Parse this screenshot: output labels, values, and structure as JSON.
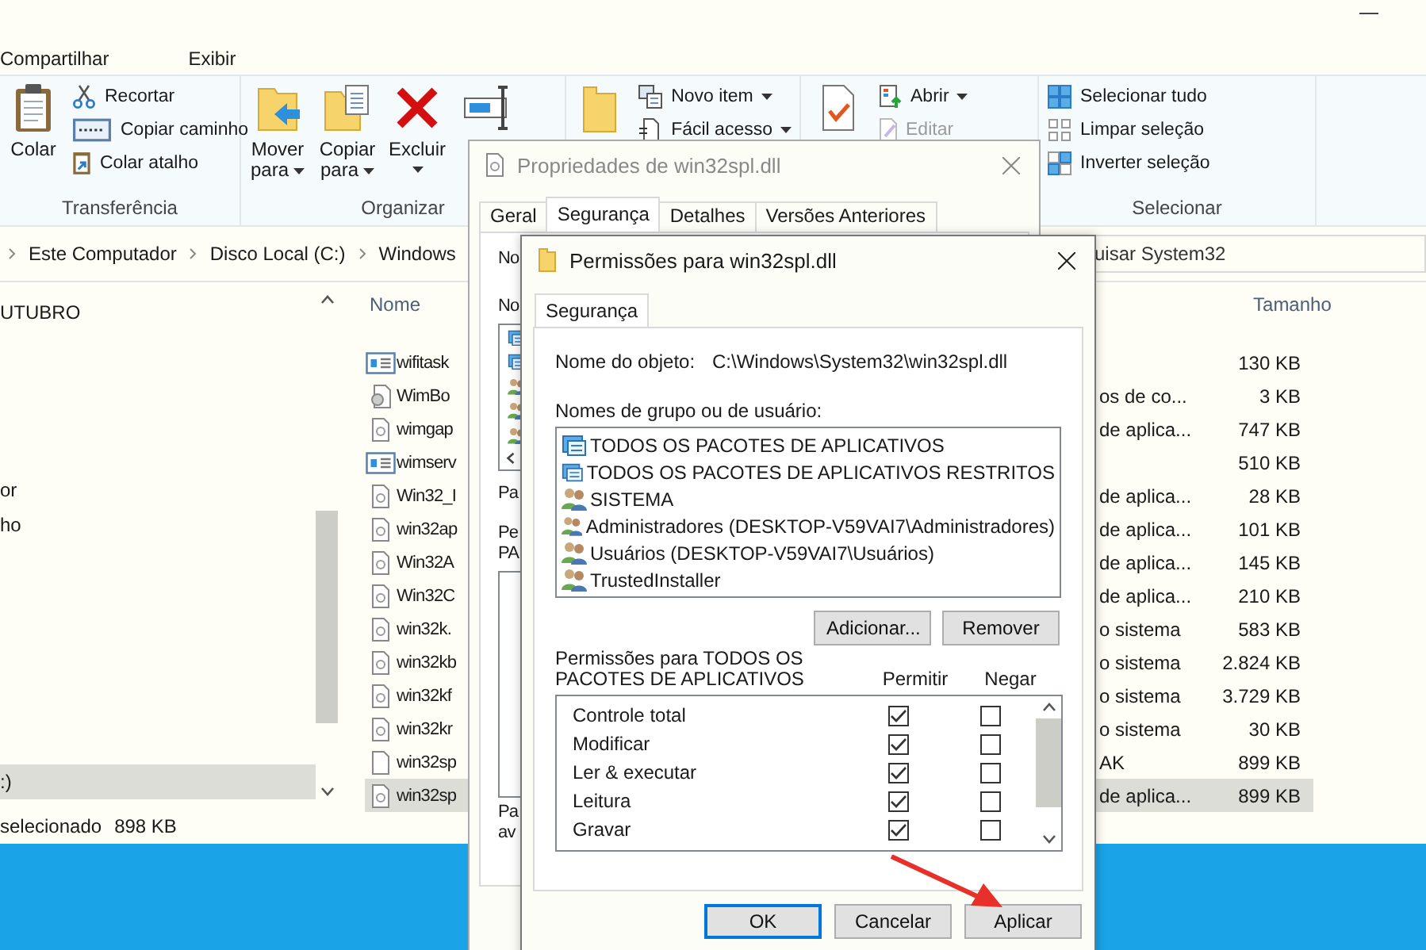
{
  "explorer": {
    "menu_tabs": [
      "Compartilhar",
      "Exibir"
    ],
    "ribbon_groups": [
      {
        "label": "Transferência",
        "large": [
          {
            "kind": "clipboard",
            "lines": [
              "Colar"
            ],
            "dropdown": false
          }
        ],
        "small": [
          {
            "kind": "scissors",
            "label": "Recortar"
          },
          {
            "kind": "path",
            "label": "Copiar caminho"
          },
          {
            "kind": "shortcut",
            "label": "Colar atalho"
          }
        ]
      },
      {
        "label": "Organizar",
        "large": [
          {
            "kind": "move",
            "lines": [
              "Mover",
              "para"
            ],
            "dropdown": true
          },
          {
            "kind": "copy",
            "lines": [
              "Copiar",
              "para"
            ],
            "dropdown": true
          },
          {
            "kind": "delete",
            "lines": [
              "Excluir"
            ],
            "dropdown": true
          },
          {
            "kind": "rename"
          }
        ]
      },
      {
        "large": [
          {
            "kind": "folder",
            "dropdown": false
          }
        ],
        "small": [
          {
            "kind": "newitem",
            "label": "Novo item",
            "dropdown": true,
            "disabled": false
          },
          {
            "kind": "easyaccess",
            "label": "Fácil acesso",
            "dropdown": true,
            "disabled": false
          }
        ]
      },
      {
        "large": [
          {
            "kind": "properties"
          }
        ],
        "small": [
          {
            "kind": "open",
            "label": "Abrir",
            "dropdown": true,
            "disabled": false
          },
          {
            "kind": "edit",
            "label": "Editar",
            "dropdown": false,
            "disabled": true
          }
        ]
      },
      {
        "label": "Selecionar",
        "small": [
          {
            "kind": "selectall",
            "label": "Selecionar tudo"
          },
          {
            "kind": "selectnone",
            "label": "Limpar seleção"
          },
          {
            "kind": "invert",
            "label": "Inverter seleção"
          }
        ]
      }
    ],
    "breadcrumb": [
      "Este Computador",
      "Disco Local (C:)",
      "Windows"
    ],
    "search": {
      "placeholder": "uisar System32"
    },
    "nav_items": [
      {
        "label": "UTUBRO",
        "selected": false
      },
      {
        "label": "or",
        "selected": false
      },
      {
        "label": "ho",
        "selected": false
      },
      {
        "label": ":)",
        "selected": true
      }
    ],
    "columns": [
      "Nome",
      "Tamanho"
    ],
    "files": [
      {
        "kind": "app",
        "name": "wifitask",
        "size": "130 KB",
        "selected": false
      },
      {
        "kind": "gear",
        "name": "WimBo",
        "type": "os de co...",
        "size": "3 KB",
        "selected": false
      },
      {
        "kind": "dll",
        "name": "wimgap",
        "type": "de aplica...",
        "size": "747 KB",
        "selected": false
      },
      {
        "kind": "app",
        "name": "wimserv",
        "size": "510 KB",
        "selected": false
      },
      {
        "kind": "dll",
        "name": "Win32_I",
        "type": "de aplica...",
        "size": "28 KB",
        "selected": false
      },
      {
        "kind": "dll",
        "name": "win32ap",
        "type": "de aplica...",
        "size": "101 KB",
        "selected": false
      },
      {
        "kind": "dll",
        "name": "Win32A",
        "type": "de aplica...",
        "size": "145 KB",
        "selected": false
      },
      {
        "kind": "dll",
        "name": "Win32C",
        "type": "de aplica...",
        "size": "210 KB",
        "selected": false
      },
      {
        "kind": "dll",
        "name": "win32k.",
        "type": "o sistema",
        "size": "583 KB",
        "selected": false
      },
      {
        "kind": "dll",
        "name": "win32kb",
        "type": "o sistema",
        "size": "2.824 KB",
        "selected": false
      },
      {
        "kind": "dll",
        "name": "win32kf",
        "type": "o sistema",
        "size": "3.729 KB",
        "selected": false
      },
      {
        "kind": "dll",
        "name": "win32kr",
        "type": "o sistema",
        "size": "30 KB",
        "selected": false
      },
      {
        "kind": "blank",
        "name": "win32sp",
        "type": "AK",
        "size": "899 KB",
        "selected": false
      },
      {
        "kind": "dll",
        "name": "win32sp",
        "type": "de aplica...",
        "size": "899 KB",
        "selected": true
      }
    ],
    "status": [
      "selecionado",
      "898 KB"
    ]
  },
  "properties_dialog": {
    "title": "Propriedades de win32spl.dll",
    "tabs": [
      {
        "label": "Geral",
        "selected": false
      },
      {
        "label": "Segurança",
        "selected": true
      },
      {
        "label": "Detalhes",
        "selected": false
      },
      {
        "label": "Versões Anteriores",
        "selected": false
      }
    ],
    "fragments": {
      "object": "No",
      "groups": "No",
      "group_items": [
        {
          "kind": "package"
        },
        {
          "kind": "package"
        },
        {
          "kind": "users"
        },
        {
          "kind": "users"
        },
        {
          "kind": "users"
        }
      ],
      "edit": "Pa",
      "permissions": [
        "Pe",
        "PA"
      ],
      "advanced": [
        "Pa",
        "av"
      ]
    }
  },
  "permissions_dialog": {
    "title": "Permissões para win32spl.dll",
    "tab": "Segurança",
    "object_label": "Nome do objeto:",
    "object_path": "C:\\Windows\\System32\\win32spl.dll",
    "groups_label": "Nomes de grupo ou de usuário:",
    "groups": [
      {
        "kind": "package",
        "name": "TODOS OS PACOTES DE APLICATIVOS"
      },
      {
        "kind": "package",
        "name": "TODOS OS PACOTES DE APLICATIVOS RESTRITOS"
      },
      {
        "kind": "users",
        "name": "SISTEMA"
      },
      {
        "kind": "users",
        "name": "Administradores (DESKTOP-V59VAI7\\Administradores)"
      },
      {
        "kind": "users",
        "name": "Usuários (DESKTOP-V59VAI7\\Usuários)"
      },
      {
        "kind": "users",
        "name": "TrustedInstaller"
      }
    ],
    "group_buttons": [
      "Adicionar...",
      "Remover"
    ],
    "permissions_label": "Permissões para TODOS OS PACOTES DE APLICATIVOS",
    "allow_label": "Permitir",
    "deny_label": "Negar",
    "permissions": [
      {
        "name": "Controle total",
        "allow": true,
        "deny": false
      },
      {
        "name": "Modificar",
        "allow": true,
        "deny": false
      },
      {
        "name": "Ler & executar",
        "allow": true,
        "deny": false
      },
      {
        "name": "Leitura",
        "allow": true,
        "deny": false
      },
      {
        "name": "Gravar",
        "allow": true,
        "deny": false
      }
    ],
    "buttons": [
      {
        "label": "OK",
        "default": true
      },
      {
        "label": "Cancelar",
        "default": false
      },
      {
        "label": "Aplicar",
        "default": false
      }
    ]
  }
}
